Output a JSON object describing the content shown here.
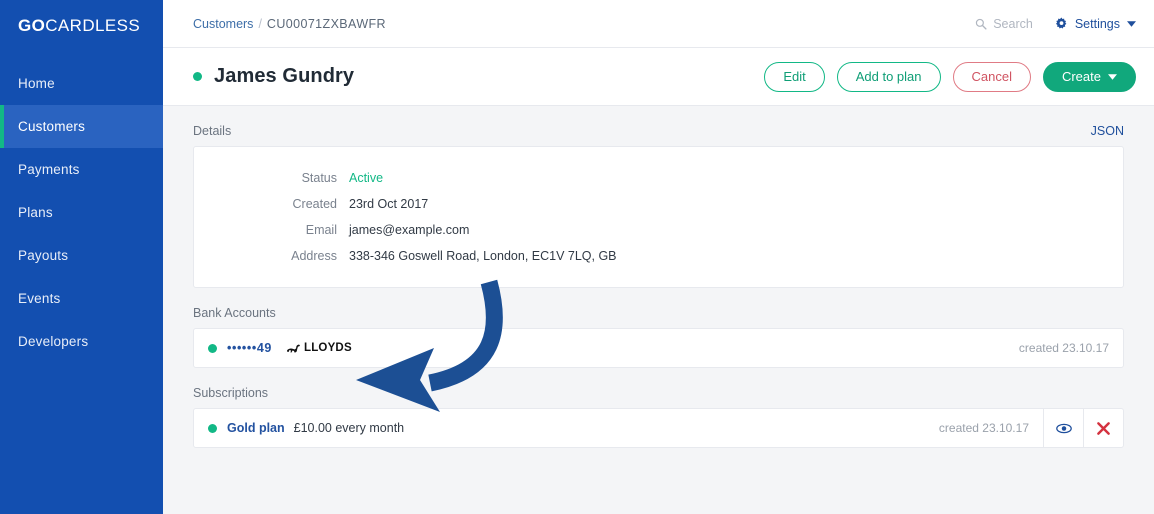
{
  "brand": {
    "logo_go": "GO",
    "logo_cardless": "CARDLESS",
    "primary_blue": "#134fb0",
    "accent_green": "#12b886",
    "link_blue": "#1f4f9c",
    "danger_red": "#d05462"
  },
  "sidebar": {
    "items": [
      {
        "label": "Home",
        "active": false
      },
      {
        "label": "Customers",
        "active": true
      },
      {
        "label": "Payments",
        "active": false
      },
      {
        "label": "Plans",
        "active": false
      },
      {
        "label": "Payouts",
        "active": false
      },
      {
        "label": "Events",
        "active": false
      },
      {
        "label": "Developers",
        "active": false
      }
    ]
  },
  "topbar": {
    "breadcrumb_root": "Customers",
    "breadcrumb_sep": "/",
    "breadcrumb_id": "CU00071ZXBAWFR",
    "search_label": "Search",
    "search_icon": "search-icon",
    "settings_label": "Settings",
    "settings_icon": "gear-icon",
    "settings_caret": "chevron-down-icon"
  },
  "header": {
    "status_dot": "status-dot-active",
    "customer_name": "James Gundry",
    "buttons": [
      {
        "label": "Edit",
        "style": "outline-teal"
      },
      {
        "label": "Add to plan",
        "style": "outline-teal"
      },
      {
        "label": "Cancel",
        "style": "outline-red"
      },
      {
        "label": "Create",
        "style": "solid-teal",
        "caret": true
      }
    ]
  },
  "details": {
    "section_title": "Details",
    "json_link": "JSON",
    "rows": [
      {
        "label": "Status",
        "value": "Active",
        "green": true
      },
      {
        "label": "Created",
        "value": "23rd Oct 2017",
        "green": false
      },
      {
        "label": "Email",
        "value": "james@example.com",
        "green": false
      },
      {
        "label": "Address",
        "value": "338-346 Goswell Road, London, EC1V 7LQ, GB",
        "green": false
      }
    ]
  },
  "bank_accounts": {
    "section_title": "Bank Accounts",
    "rows": [
      {
        "status_dot": "status-dot-active",
        "account_number": "••••••49",
        "bank_name": "LLOYDS",
        "bank_logo": "lloyds-horse-icon",
        "created": "created 23.10.17"
      }
    ]
  },
  "subscriptions": {
    "section_title": "Subscriptions",
    "rows": [
      {
        "status_dot": "status-dot-active",
        "plan_name": "Gold plan",
        "description": "£10.00 every month",
        "created": "created 23.10.17",
        "view_icon": "eye-icon",
        "cancel_icon": "close-x-icon"
      }
    ]
  },
  "annotation": {
    "type": "curved-arrow",
    "color": "#1c4f94",
    "points_to": "bank-accounts-row"
  }
}
